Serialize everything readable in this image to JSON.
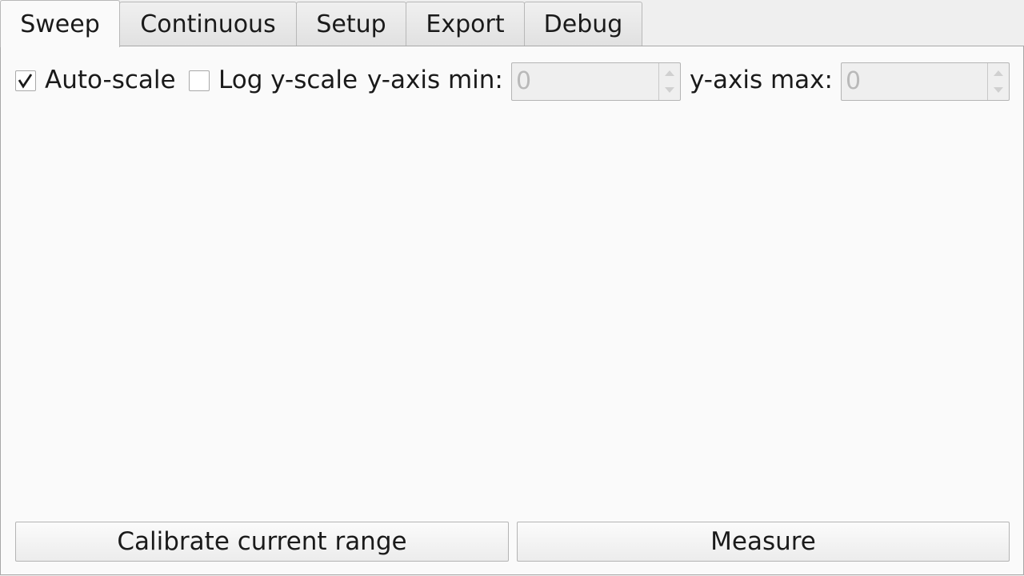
{
  "tabs": [
    {
      "label": "Sweep",
      "active": true
    },
    {
      "label": "Continuous",
      "active": false
    },
    {
      "label": "Setup",
      "active": false
    },
    {
      "label": "Export",
      "active": false
    },
    {
      "label": "Debug",
      "active": false
    }
  ],
  "controls": {
    "autoscale": {
      "label": "Auto-scale",
      "checked": true
    },
    "logscale": {
      "label": "Log y-scale",
      "checked": false
    },
    "ymin": {
      "label": "y-axis min:",
      "value": "0",
      "enabled": false
    },
    "ymax": {
      "label": "y-axis max:",
      "value": "0",
      "enabled": false
    }
  },
  "buttons": {
    "calibrate": "Calibrate current range",
    "measure": "Measure"
  },
  "icons": {
    "check": "checkmark-icon",
    "spin_up": "spin-up-arrow-icon",
    "spin_down": "spin-down-arrow-icon"
  },
  "colors": {
    "panel_bg": "#fafafa",
    "window_bg": "#efefef",
    "disabled_text": "#b9b9b9"
  }
}
